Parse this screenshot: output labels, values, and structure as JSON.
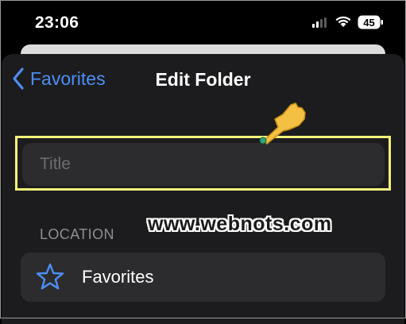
{
  "status_bar": {
    "time": "23:06",
    "battery_level": "45"
  },
  "nav": {
    "back_label": "Favorites",
    "title": "Edit Folder"
  },
  "title_field": {
    "value": "",
    "placeholder": "Title"
  },
  "location": {
    "section_label": "LOCATION",
    "item_label": "Favorites",
    "item_icon": "star-icon"
  },
  "watermark": "www.webnots.com",
  "colors": {
    "accent": "#4e8ef2",
    "sheet_bg": "#1c1c1e",
    "field_bg": "#2c2c2e",
    "highlight": "#f4f27a",
    "hand": "#f3c043"
  }
}
